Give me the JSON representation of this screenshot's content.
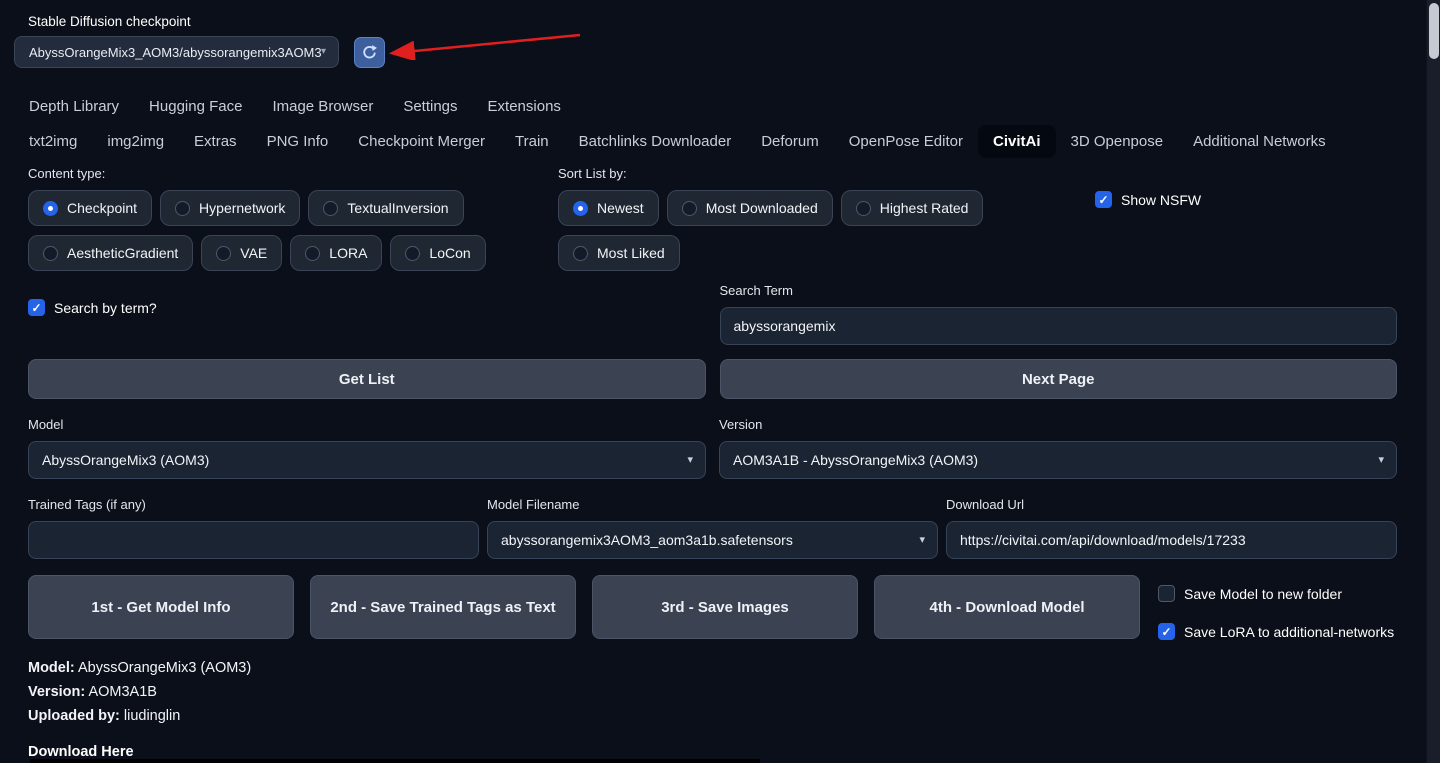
{
  "icons": {
    "caret_down": "▾",
    "check": "✓"
  },
  "header": {
    "checkpoint_label": "Stable Diffusion checkpoint",
    "checkpoint_value": "AbyssOrangeMix3_AOM3/abyssorangemix3AOM3_"
  },
  "nav": {
    "secondary": [
      "Depth Library",
      "Hugging Face",
      "Image Browser",
      "Settings",
      "Extensions"
    ],
    "primary": [
      "txt2img",
      "img2img",
      "Extras",
      "PNG Info",
      "Checkpoint Merger",
      "Train",
      "Batchlinks Downloader",
      "Deforum",
      "OpenPose Editor",
      "CivitAi",
      "3D Openpose",
      "Additional Networks"
    ],
    "active_tab": "CivitAi"
  },
  "filters": {
    "content_type_label": "Content type:",
    "content_type_options": [
      "Checkpoint",
      "Hypernetwork",
      "TextualInversion",
      "AestheticGradient",
      "VAE",
      "LORA",
      "LoCon"
    ],
    "content_type_selected": "Checkpoint",
    "sort_label": "Sort List by:",
    "sort_options": [
      "Newest",
      "Most Downloaded",
      "Highest Rated",
      "Most Liked"
    ],
    "sort_selected": "Newest",
    "show_nsfw_label": "Show NSFW",
    "show_nsfw_checked": true
  },
  "search": {
    "by_term_label": "Search by term?",
    "by_term_checked": true,
    "term_label": "Search Term",
    "term_value": "abyssorangemix"
  },
  "list_buttons": {
    "get_list": "Get List",
    "next_page": "Next Page"
  },
  "model_section": {
    "model_label": "Model",
    "model_value": "AbyssOrangeMix3 (AOM3)",
    "version_label": "Version",
    "version_value": "AOM3A1B - AbyssOrangeMix3 (AOM3)",
    "trained_tags_label": "Trained Tags (if any)",
    "trained_tags_value": "",
    "filename_label": "Model Filename",
    "filename_value": "abyssorangemix3AOM3_aom3a1b.safetensors",
    "download_url_label": "Download Url",
    "download_url_value": "https://civitai.com/api/download/models/17233"
  },
  "steps": {
    "step1": "1st - Get Model Info",
    "step2": "2nd - Save Trained Tags as Text",
    "step3": "3rd - Save Images",
    "step4": "4th - Download Model"
  },
  "save_options": {
    "new_folder_label": "Save Model to new folder",
    "new_folder_checked": false,
    "lora_label": "Save LoRA to additional-networks",
    "lora_checked": true
  },
  "model_info": {
    "model_label": "Model:",
    "model_value": "AbyssOrangeMix3 (AOM3)",
    "version_label": "Version:",
    "version_value": "AOM3A1B",
    "uploaded_label": "Uploaded by:",
    "uploaded_value": "liudinglin",
    "download_here": "Download Here"
  }
}
